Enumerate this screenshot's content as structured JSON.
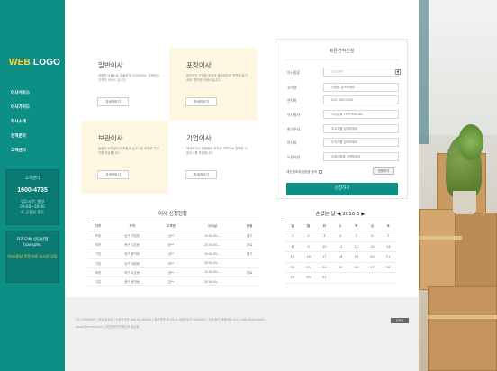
{
  "logo": {
    "web": "WEB",
    "rest": " LOGO"
  },
  "sidebar": {
    "nav": [
      "이사서비스",
      "이사가이드",
      "회사소개",
      "견적문의",
      "고객센터"
    ],
    "box1": {
      "title": "고객센터",
      "phone": "1600-4735",
      "hours1": "업무시간: 평일",
      "hours2": "09:00~18:00",
      "hours3": "토,공휴일 휴무"
    },
    "box2": {
      "line1": "카카오톡 상담신청",
      "line2": "(sample)",
      "line3": "이사/용달 전문가와 실시간 상담"
    }
  },
  "services": [
    {
      "title": "일반이사",
      "desc": "저렴한 비용으로 알뜰하게 이사하세요. 경제적인 가격의 서비스 입니다.",
      "btn": "자세히보기"
    },
    {
      "title": "포장이사",
      "desc": "합리적인 가격에 포장과 정리정돈을 한번에 맡기세요. 편리한 서비스입니다.",
      "btn": "자세히보기"
    },
    {
      "title": "보관이사",
      "desc": "출발지 도착일이 보관필요 입고 1일 보관료 무료 이용 가능합니다.",
      "btn": "자세히보기"
    },
    {
      "title": "기업이사",
      "desc": "체계적이고 전문화된 조직과 계획으로 완벽한 기업이사를 보장합니다.",
      "btn": "자세히보기"
    }
  ],
  "quote": {
    "title": "빠른견적신청",
    "fields": [
      {
        "label": "이사종류",
        "value": "이사선택",
        "type": "select"
      },
      {
        "label": "고객명",
        "placeholder": "이름을 입력하세요",
        "type": "input"
      },
      {
        "label": "연락처",
        "placeholder": "010-000-0000",
        "type": "input"
      },
      {
        "label": "이사일자",
        "placeholder": "이사날짜 YYYY-MM-DD",
        "type": "input"
      },
      {
        "label": "현거주지",
        "placeholder": "주소지를 입력하세요",
        "type": "input"
      },
      {
        "label": "이사지",
        "placeholder": "도착지를 입력하세요",
        "type": "input"
      },
      {
        "label": "요청사항",
        "placeholder": "요청사항을 입력하세요",
        "type": "input"
      }
    ],
    "agree_label": "개인정보취급방침 동의",
    "agree_btn": "전문보기",
    "submit": "신청하기"
  },
  "status": {
    "title": "이사 신청현황",
    "headers": [
      "지역",
      "지역",
      "고객명",
      "이사날",
      "현황"
    ],
    "rows": [
      [
        "포항",
        "남구 연일읍",
        "김**",
        "2016-05-...",
        "대기"
      ],
      [
        "포항",
        "북구 두호동",
        "정**",
        "2016-05-...",
        "완료"
      ],
      [
        "기업",
        "중구 용덕동",
        "김**",
        "2016-05-...",
        "대기"
      ],
      [
        "기업",
        "남구 대잠동",
        "최**",
        "2016-05-...",
        ""
      ],
      [
        "포항",
        "북구 두호동",
        "정**",
        "2016-05-...",
        "완료"
      ],
      [
        "기업",
        "중구 용덕동",
        "김**",
        "2016-05-...",
        ""
      ]
    ]
  },
  "calendar": {
    "title": "손없는 날 ◀ 2016.5 ▶",
    "headers": [
      "일",
      "월",
      "화",
      "수",
      "목",
      "금",
      "토"
    ],
    "weeks": [
      [
        "1",
        "2",
        "3",
        "4",
        "5",
        "6",
        "7"
      ],
      [
        "8",
        "9",
        "10",
        "11",
        "12",
        "13",
        "14"
      ],
      [
        "15",
        "16",
        "17",
        "18",
        "19",
        "20",
        "21"
      ],
      [
        "22",
        "23",
        "24",
        "25",
        "26",
        "27",
        "28"
      ],
      [
        "29",
        "30",
        "31",
        "",
        "",
        "",
        ""
      ]
    ]
  },
  "footer": {
    "line1": "(주)COMPANY | 대표 홍길동 | 사업자번호 000-00-00000 | 통신판매 제 2016-서울강남구-00000호 | 서울 중구 세종대로 110 | 000-0000-0000",
    "line2": "email@email.com | 개인정보관리책임자 홍길동",
    "badge": "관리자"
  }
}
